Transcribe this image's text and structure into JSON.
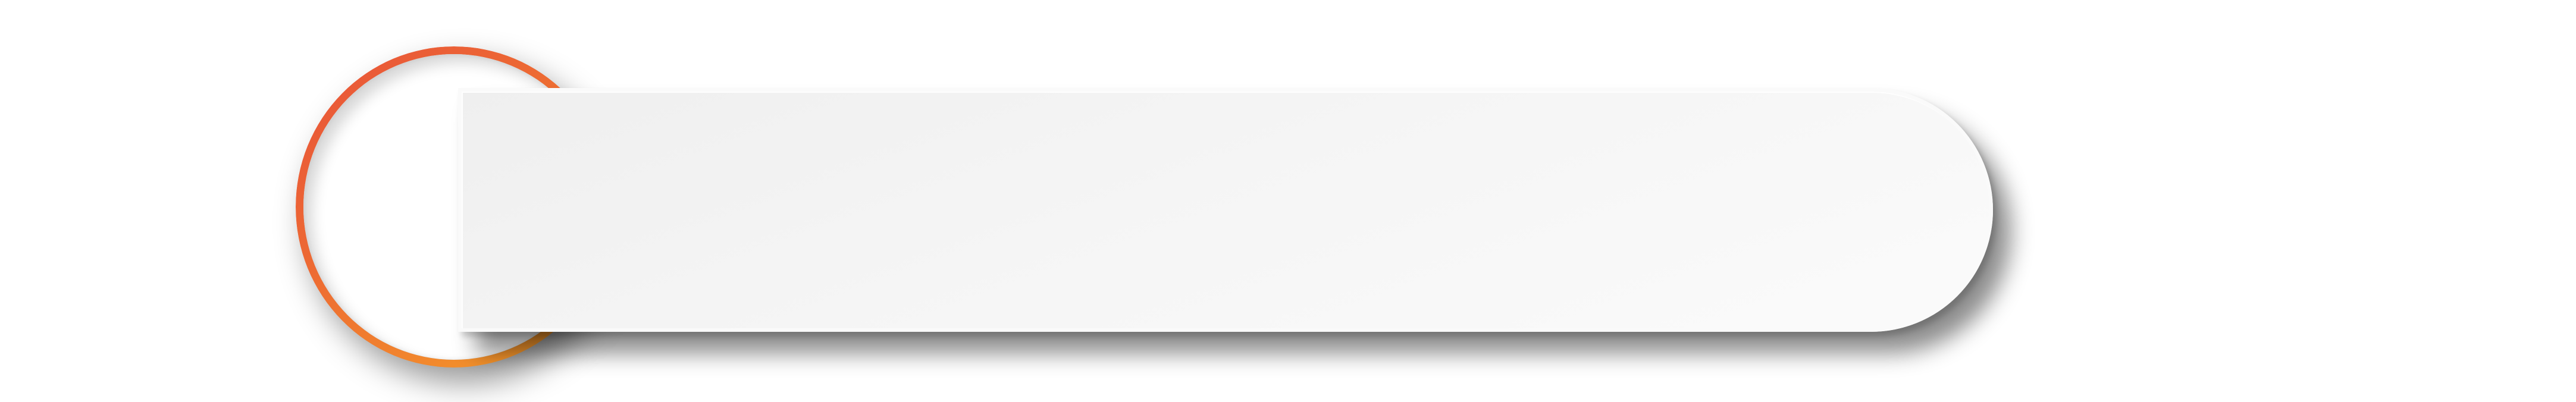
{
  "graphic": {
    "ring_label": "",
    "banner_label": "",
    "colors": {
      "ring_gradient_start": "#e8523a",
      "ring_gradient_end": "#f7a82a",
      "banner_fill": "#f4f4f4",
      "background": "#ffffff"
    },
    "icon": "ring-banner-graphic"
  }
}
